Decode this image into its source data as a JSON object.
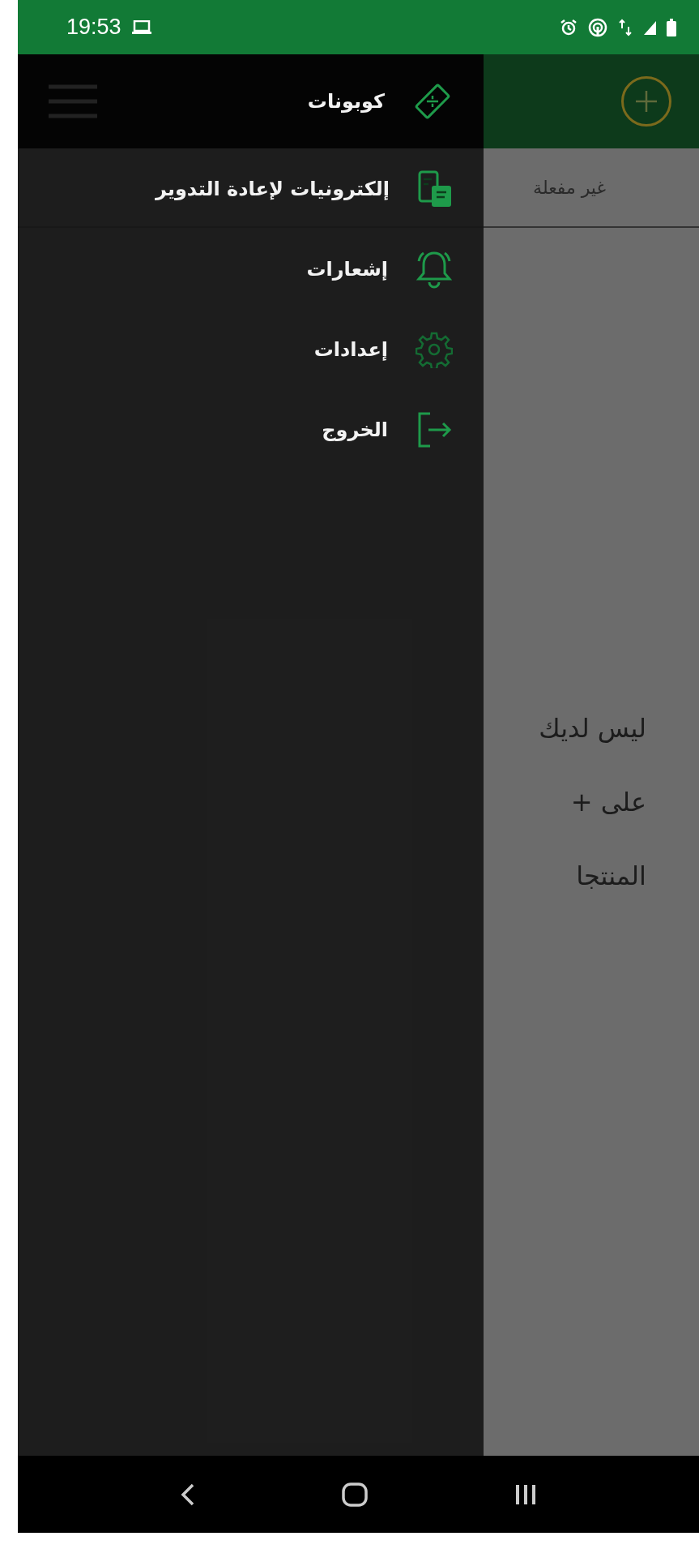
{
  "status_bar": {
    "time": "19:53"
  },
  "app": {
    "tab": {
      "label": "غير مفعلة"
    },
    "empty_message_lines": [
      "ليس لديك",
      "على +",
      "المنتجا"
    ]
  },
  "drawer": {
    "items": [
      {
        "label": "كوبونات",
        "kind": "coupon",
        "selected": true
      },
      {
        "label": "إلكترونيات لإعادة التدوير",
        "kind": "electronics",
        "selected": false
      },
      {
        "label": "إشعارات",
        "kind": "bell",
        "selected": false
      },
      {
        "label": "إعدادات",
        "kind": "gear",
        "selected": false
      },
      {
        "label": "الخروج",
        "kind": "logout",
        "selected": false
      }
    ]
  }
}
